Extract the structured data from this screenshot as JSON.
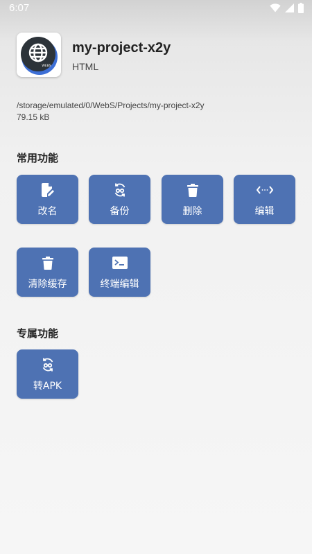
{
  "status_bar": {
    "time": "6:07"
  },
  "app": {
    "name": "my-project-x2y",
    "type": "HTML",
    "path": "/storage/emulated/0/WebS/Projects/my-project-x2y",
    "size": "79.15 kB",
    "icon_badge": "WEBS"
  },
  "sections": {
    "common": {
      "title": "常用功能",
      "buttons": [
        {
          "label": "改名",
          "icon": "rename-icon"
        },
        {
          "label": "备份",
          "icon": "backup-icon"
        },
        {
          "label": "删除",
          "icon": "trash-icon"
        },
        {
          "label": "编辑",
          "icon": "code-icon"
        },
        {
          "label": "清除缓存",
          "icon": "trash-icon"
        },
        {
          "label": "终端编辑",
          "icon": "terminal-icon"
        }
      ]
    },
    "exclusive": {
      "title": "专属功能",
      "buttons": [
        {
          "label": "转APK",
          "icon": "convert-icon"
        }
      ]
    }
  },
  "colors": {
    "tile": "#4e72b3",
    "tile_text": "#ffffff"
  }
}
